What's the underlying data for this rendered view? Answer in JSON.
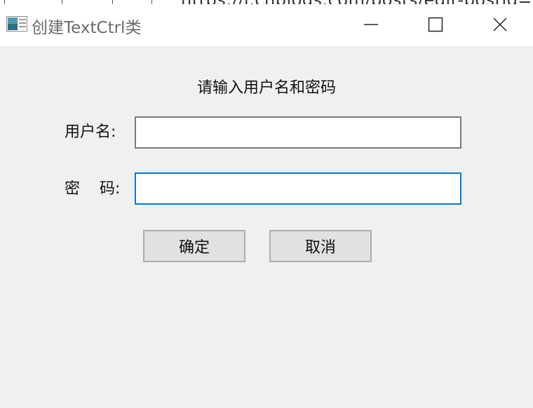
{
  "background_window": {
    "url_fragment": "https://i.cnblogs.com/posts/edit-postid="
  },
  "window": {
    "title": "创建TextCtrl类",
    "controls": {
      "minimize": "minimize-icon",
      "maximize": "maximize-icon",
      "close": "close-icon"
    }
  },
  "form": {
    "heading": "请输入用户名和密码",
    "username_label": "用户名:",
    "password_label": "密    码:",
    "username_value": "",
    "password_value": "",
    "ok_label": "确定",
    "cancel_label": "取消"
  },
  "colors": {
    "focus_border": "#0078d7",
    "window_bg": "#f0f0f0",
    "button_bg": "#e1e1e1"
  }
}
